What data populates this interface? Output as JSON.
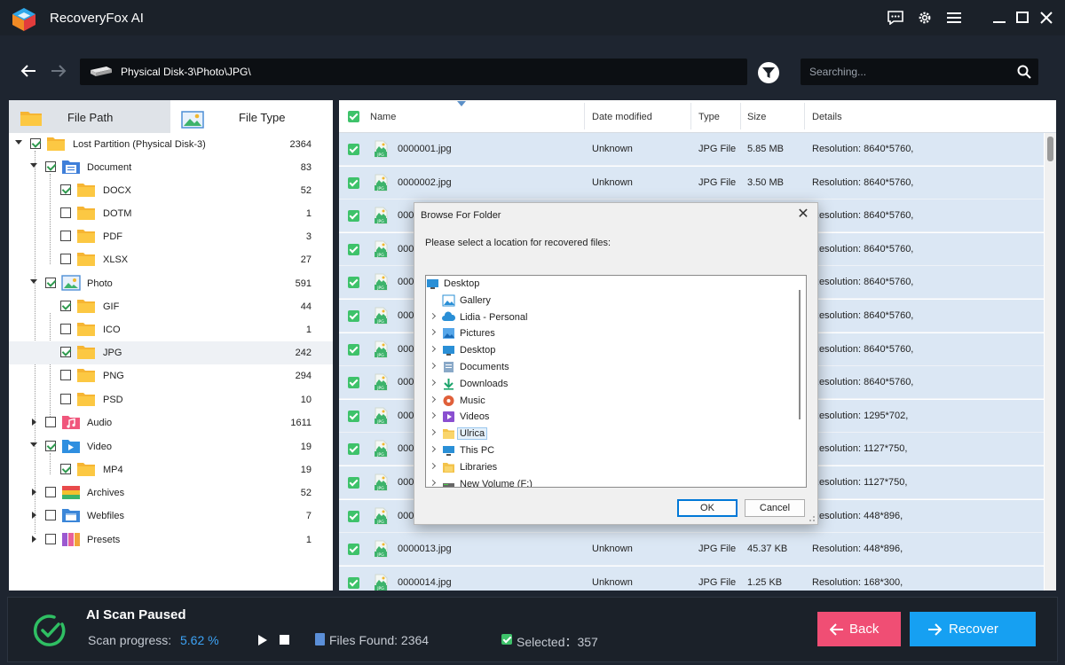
{
  "app": {
    "title": "RecoveryFox AI"
  },
  "toolbar": {
    "path": "Physical Disk-3\\Photo\\JPG\\",
    "search_placeholder": "Searching..."
  },
  "left": {
    "tabs": [
      {
        "label": "File Path"
      },
      {
        "label": "File Type"
      }
    ],
    "tree": [
      {
        "name": "Lost Partition (Physical Disk-3)",
        "count": "2364"
      },
      {
        "name": "Document",
        "count": "83"
      },
      {
        "name": "DOCX",
        "count": "52"
      },
      {
        "name": "DOTM",
        "count": "1"
      },
      {
        "name": "PDF",
        "count": "3"
      },
      {
        "name": "XLSX",
        "count": "27"
      },
      {
        "name": "Photo",
        "count": "591"
      },
      {
        "name": "GIF",
        "count": "44"
      },
      {
        "name": "ICO",
        "count": "1"
      },
      {
        "name": "JPG",
        "count": "242"
      },
      {
        "name": "PNG",
        "count": "294"
      },
      {
        "name": "PSD",
        "count": "10"
      },
      {
        "name": "Audio",
        "count": "1611"
      },
      {
        "name": "Video",
        "count": "19"
      },
      {
        "name": "MP4",
        "count": "19"
      },
      {
        "name": "Archives",
        "count": "52"
      },
      {
        "name": "Webfiles",
        "count": "7"
      },
      {
        "name": "Presets",
        "count": "1"
      }
    ]
  },
  "table": {
    "headers": {
      "name": "Name",
      "date": "Date modified",
      "type": "Type",
      "size": "Size",
      "details": "Details"
    },
    "rows": [
      {
        "name": "0000001.jpg",
        "date": "Unknown",
        "type": "JPG File",
        "size": "5.85 MB",
        "details": "Resolution: 8640*5760,"
      },
      {
        "name": "0000002.jpg",
        "date": "Unknown",
        "type": "JPG File",
        "size": "3.50 MB",
        "details": "Resolution: 8640*5760,"
      },
      {
        "name": "000",
        "date": "",
        "type": "",
        "size": "",
        "details": "Resolution: 8640*5760,"
      },
      {
        "name": "000",
        "date": "",
        "type": "",
        "size": "",
        "details": "Resolution: 8640*5760,"
      },
      {
        "name": "000",
        "date": "",
        "type": "",
        "size": "",
        "details": "Resolution: 8640*5760,"
      },
      {
        "name": "000",
        "date": "",
        "type": "",
        "size": "",
        "details": "Resolution: 8640*5760,"
      },
      {
        "name": "000",
        "date": "",
        "type": "",
        "size": "",
        "details": "Resolution: 8640*5760,"
      },
      {
        "name": "000",
        "date": "",
        "type": "",
        "size": "",
        "details": "Resolution: 8640*5760,"
      },
      {
        "name": "000",
        "date": "",
        "type": "",
        "size": "",
        "details": "Resolution: 1295*702,"
      },
      {
        "name": "000",
        "date": "",
        "type": "",
        "size": "",
        "details": "Resolution: 1127*750,"
      },
      {
        "name": "000",
        "date": "",
        "type": "",
        "size": "",
        "details": "Resolution: 1127*750,"
      },
      {
        "name": "000",
        "date": "",
        "type": "",
        "size": "",
        "details": "Resolution: 448*896,"
      },
      {
        "name": "0000013.jpg",
        "date": "Unknown",
        "type": "JPG File",
        "size": "45.37 KB",
        "details": "Resolution: 448*896,"
      },
      {
        "name": "0000014.jpg",
        "date": "Unknown",
        "type": "JPG File",
        "size": "1.25 KB",
        "details": "Resolution: 168*300,"
      }
    ]
  },
  "dialog": {
    "title": "Browse For Folder",
    "prompt": "Please select a location for recovered files:",
    "items": [
      {
        "label": "Desktop",
        "icon": "desktop-icon"
      },
      {
        "label": "Gallery",
        "icon": "gallery-icon"
      },
      {
        "label": "Lidia - Personal",
        "icon": "cloud-icon"
      },
      {
        "label": "Pictures",
        "icon": "pictures-icon"
      },
      {
        "label": "Desktop",
        "icon": "desktop-icon"
      },
      {
        "label": "Documents",
        "icon": "documents-icon"
      },
      {
        "label": "Downloads",
        "icon": "download-icon"
      },
      {
        "label": "Music",
        "icon": "music-icon"
      },
      {
        "label": "Videos",
        "icon": "videos-icon"
      },
      {
        "label": "Ulrica",
        "icon": "folder-icon"
      },
      {
        "label": "This PC",
        "icon": "pc-icon"
      },
      {
        "label": "Libraries",
        "icon": "libraries-icon"
      },
      {
        "label": "New Volume (F:)",
        "icon": "drive-icon"
      }
    ],
    "ok_label": "OK",
    "cancel_label": "Cancel"
  },
  "status": {
    "title": "AI Scan Paused",
    "progress_label": "Scan progress:",
    "progress_value": "5.62 %",
    "files_found": "Files Found: 2364",
    "selected": "Selected：357",
    "back_label": "Back",
    "recover_label": "Recover"
  },
  "colors": {
    "accent_green": "#3ec26a",
    "back_button": "#f04e74",
    "recover_button": "#16a0f2",
    "progress_text": "#3da3f5"
  }
}
